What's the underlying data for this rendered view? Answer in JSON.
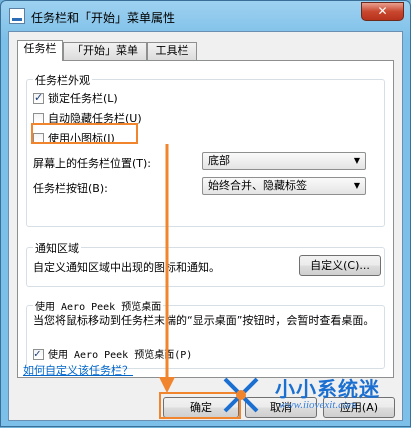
{
  "window": {
    "title": "任务栏和「开始」菜单属性",
    "close_label": "✕"
  },
  "tabs": [
    {
      "label": "任务栏",
      "active": true
    },
    {
      "label": "「开始」菜单",
      "active": false
    },
    {
      "label": "工具栏",
      "active": false
    }
  ],
  "appearance": {
    "title": "任务栏外观",
    "lock": {
      "label": "锁定任务栏(L)",
      "checked": true
    },
    "autohide": {
      "label": "自动隐藏任务栏(U)",
      "checked": false
    },
    "small_icons": {
      "label": "使用小图标(I)",
      "checked": false
    },
    "location_label": "屏幕上的任务栏位置(T):",
    "location_value": "底部",
    "buttons_label": "任务栏按钮(B):",
    "buttons_value": "始终合并、隐藏标签"
  },
  "notification": {
    "title": "通知区域",
    "description": "自定义通知区域中出现的图标和通知。",
    "customize_label": "自定义(C)..."
  },
  "aero": {
    "title": "使用 Aero Peek 预览桌面",
    "description": "当您将鼠标移动到任务栏末端的“显示桌面”按钮时，会暂时查看桌面。",
    "checkbox": {
      "label": "使用 Aero Peek 预览桌面(P)",
      "checked": true
    }
  },
  "footer": {
    "help_link": "如何自定义该任务栏？",
    "ok_label": "确定",
    "cancel_label": "取消",
    "apply_label": "应用(A)"
  },
  "watermark": {
    "title": "小小系统迷",
    "url": "www.iiovexit.com"
  },
  "colors": {
    "highlight": "#f0852e",
    "link": "#0066cc",
    "watermark": "#1a6fd1"
  }
}
